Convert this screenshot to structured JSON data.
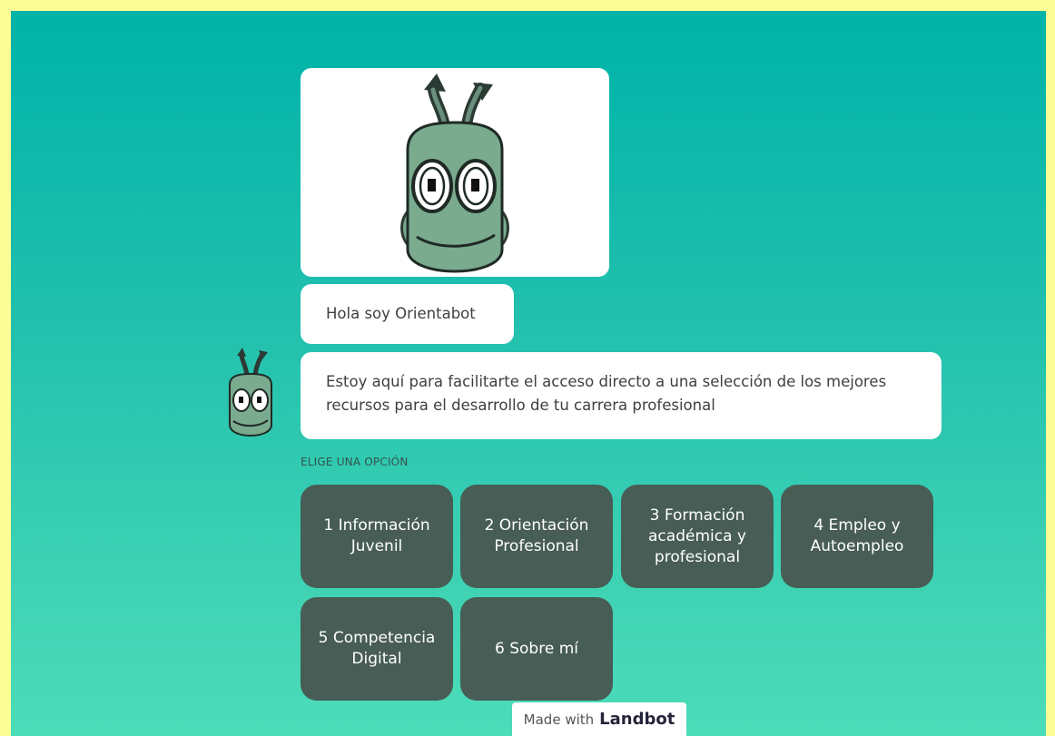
{
  "chat": {
    "greeting": "Hola soy Orientabot",
    "intro": "Estoy aquí para facilitarte el acceso directo a una selección de los mejores recursos para el desarrollo de tu carrera profesional",
    "prompt": "ELIGE UNA OPCIÓN",
    "bot_image_icon": "orientabot-robot-icon",
    "avatar_icon": "orientabot-avatar-icon"
  },
  "options": [
    "1 Información Juvenil",
    "2 Orientación Profesional",
    "3 Formación académica y profesional",
    "4 Empleo y Autoempleo",
    "5 Competencia Digital",
    "6 Sobre mí"
  ],
  "footer": {
    "made_with": "Made with",
    "brand": "Landbot"
  },
  "colors": {
    "page_border": "#fdfd96",
    "gradient_top": "#00b3a8",
    "gradient_bottom": "#4cdcb9",
    "option_bg": "#475d55",
    "robot_green": "#7aab8f"
  }
}
